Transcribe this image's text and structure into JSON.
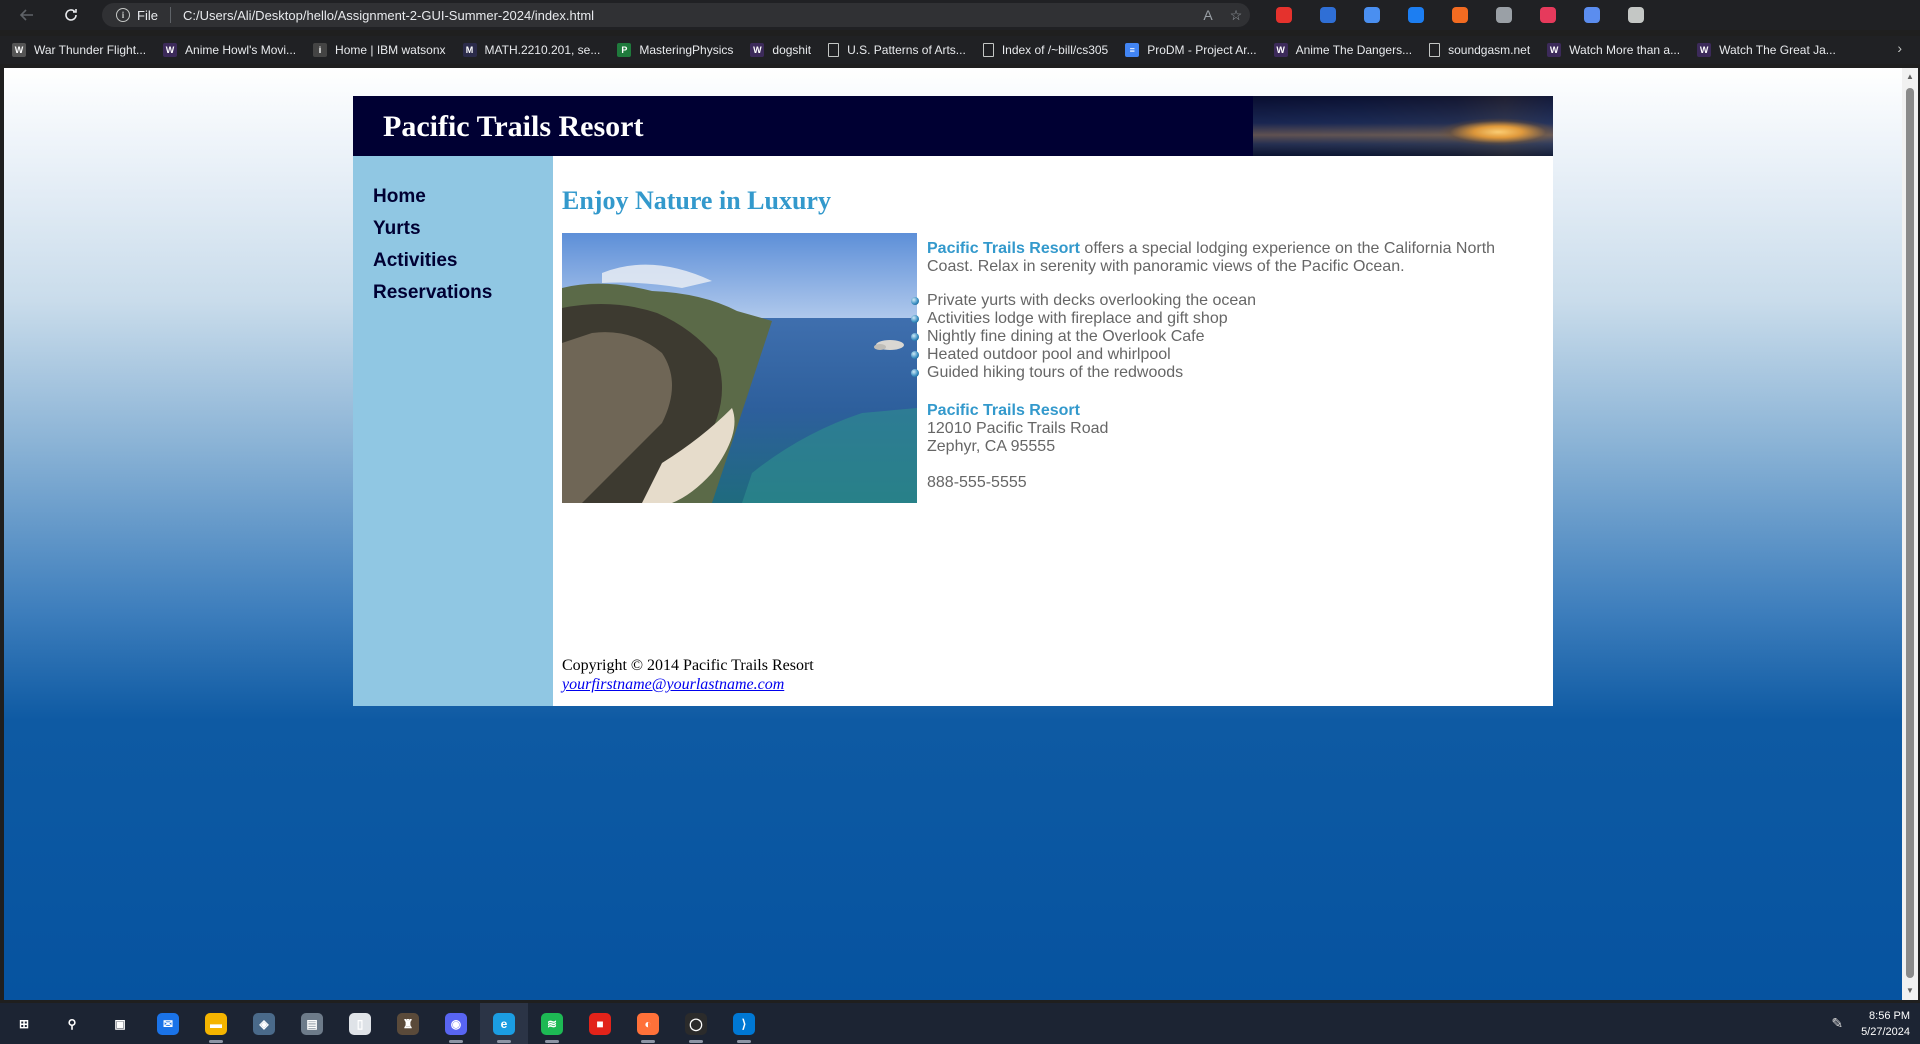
{
  "browser": {
    "address_label": "File",
    "url": "C:/Users/Ali/Desktop/hello/Assignment-2-GUI-Summer-2024/index.html",
    "extensions": [
      {
        "name": "adblock-icon",
        "color": "#e5322d"
      },
      {
        "name": "speaker-icon",
        "color": "#2f6fd6"
      },
      {
        "name": "search-ext-icon",
        "color": "#4a8ff0"
      },
      {
        "name": "shazam-icon",
        "color": "#1c7ef2"
      },
      {
        "name": "honey-icon",
        "color": "#f26b21"
      },
      {
        "name": "pen-ext-icon",
        "color": "#9aa0a6"
      },
      {
        "name": "record-icon",
        "color": "#e63a5c"
      },
      {
        "name": "collections-ext-icon",
        "color": "#5b8def"
      },
      {
        "name": "puzzle-icon",
        "color": "#c4c7c5"
      }
    ]
  },
  "bookmarks": [
    {
      "label": "War Thunder Flight...",
      "icon": "W",
      "color": "#555555"
    },
    {
      "label": "Anime Howl's Movi...",
      "icon": "W",
      "color": "#3c2a5a"
    },
    {
      "label": "Home | IBM watsonx",
      "icon": "i",
      "color": "#444444"
    },
    {
      "label": "MATH.2210.201, se...",
      "icon": "M",
      "color": "#2b2b4a"
    },
    {
      "label": "MasteringPhysics",
      "icon": "P",
      "color": "#1f7a3c"
    },
    {
      "label": "dogshit",
      "icon": "W",
      "color": "#3c2a5a"
    },
    {
      "label": "U.S. Patterns of Arts...",
      "icon": "",
      "color": "#202124"
    },
    {
      "label": "Index of /~bill/cs305",
      "icon": "",
      "color": "#202124"
    },
    {
      "label": "ProDM - Project Ar...",
      "icon": "≡",
      "color": "#4285f4"
    },
    {
      "label": "Anime The Dangers...",
      "icon": "W",
      "color": "#3c2a5a"
    },
    {
      "label": "soundgasm.net",
      "icon": "",
      "color": "#202124"
    },
    {
      "label": "Watch More than a...",
      "icon": "W",
      "color": "#3c2a5a"
    },
    {
      "label": "Watch The Great Ja...",
      "icon": "W",
      "color": "#3c2a5a"
    }
  ],
  "site": {
    "title": "Pacific Trails Resort",
    "nav": [
      "Home",
      "Yurts",
      "Activities",
      "Reservations"
    ],
    "heading": "Enjoy Nature in Luxury",
    "intro_brand": "Pacific Trails Resort",
    "intro_text": " offers a special lodging experience on the California North Coast. Relax in serenity with panoramic views of the Pacific Ocean.",
    "features": [
      "Private yurts with decks overlooking the ocean",
      "Activities lodge with fireplace and gift shop",
      "Nightly fine dining at the Overlook Cafe",
      "Heated outdoor pool and whirlpool",
      "Guided hiking tours of the redwoods"
    ],
    "contact": {
      "name": "Pacific Trails Resort",
      "street": "12010 Pacific Trails Road",
      "city": "Zephyr, CA 95555",
      "phone": "888-555-5555"
    },
    "footer": {
      "copyright": "Copyright © 2014 Pacific Trails Resort",
      "email": "yourfirstname@yourlastname.com"
    },
    "colors": {
      "header_bg": "#000033",
      "nav_bg": "#90c7e3",
      "accent": "#3399cc",
      "body_text": "#666666"
    }
  },
  "taskbar": {
    "apps": [
      {
        "name": "start-icon",
        "glyph": "⊞",
        "color": "transparent"
      },
      {
        "name": "search-icon",
        "glyph": "⚲",
        "color": "transparent"
      },
      {
        "name": "task-view-icon",
        "glyph": "▣",
        "color": "transparent"
      },
      {
        "name": "mail-icon",
        "glyph": "✉",
        "color": "#1a73e8"
      },
      {
        "name": "file-explorer-icon",
        "glyph": "▬",
        "color": "#f4b400"
      },
      {
        "name": "app-icon",
        "glyph": "◈",
        "color": "#4a6a8a"
      },
      {
        "name": "store-icon",
        "glyph": "▤",
        "color": "#6d7b8a"
      },
      {
        "name": "notepad-icon",
        "glyph": "▯",
        "color": "#dfe3e8"
      },
      {
        "name": "game-icon",
        "glyph": "♜",
        "color": "#5a4a3a"
      },
      {
        "name": "discord-icon",
        "glyph": "◉",
        "color": "#5865f2"
      },
      {
        "name": "edge-icon",
        "glyph": "e",
        "color": "#1b9de2"
      },
      {
        "name": "spotify-icon",
        "glyph": "≋",
        "color": "#1db954"
      },
      {
        "name": "roblox-icon",
        "glyph": "■",
        "color": "#e2231a"
      },
      {
        "name": "firefox-icon",
        "glyph": "◐",
        "color": "#ff7139"
      },
      {
        "name": "github-icon",
        "glyph": "◯",
        "color": "#2b2b2b"
      },
      {
        "name": "vscode-icon",
        "glyph": "⟩",
        "color": "#0078d4"
      }
    ],
    "time": "8:56 PM",
    "date": "5/27/2024"
  }
}
